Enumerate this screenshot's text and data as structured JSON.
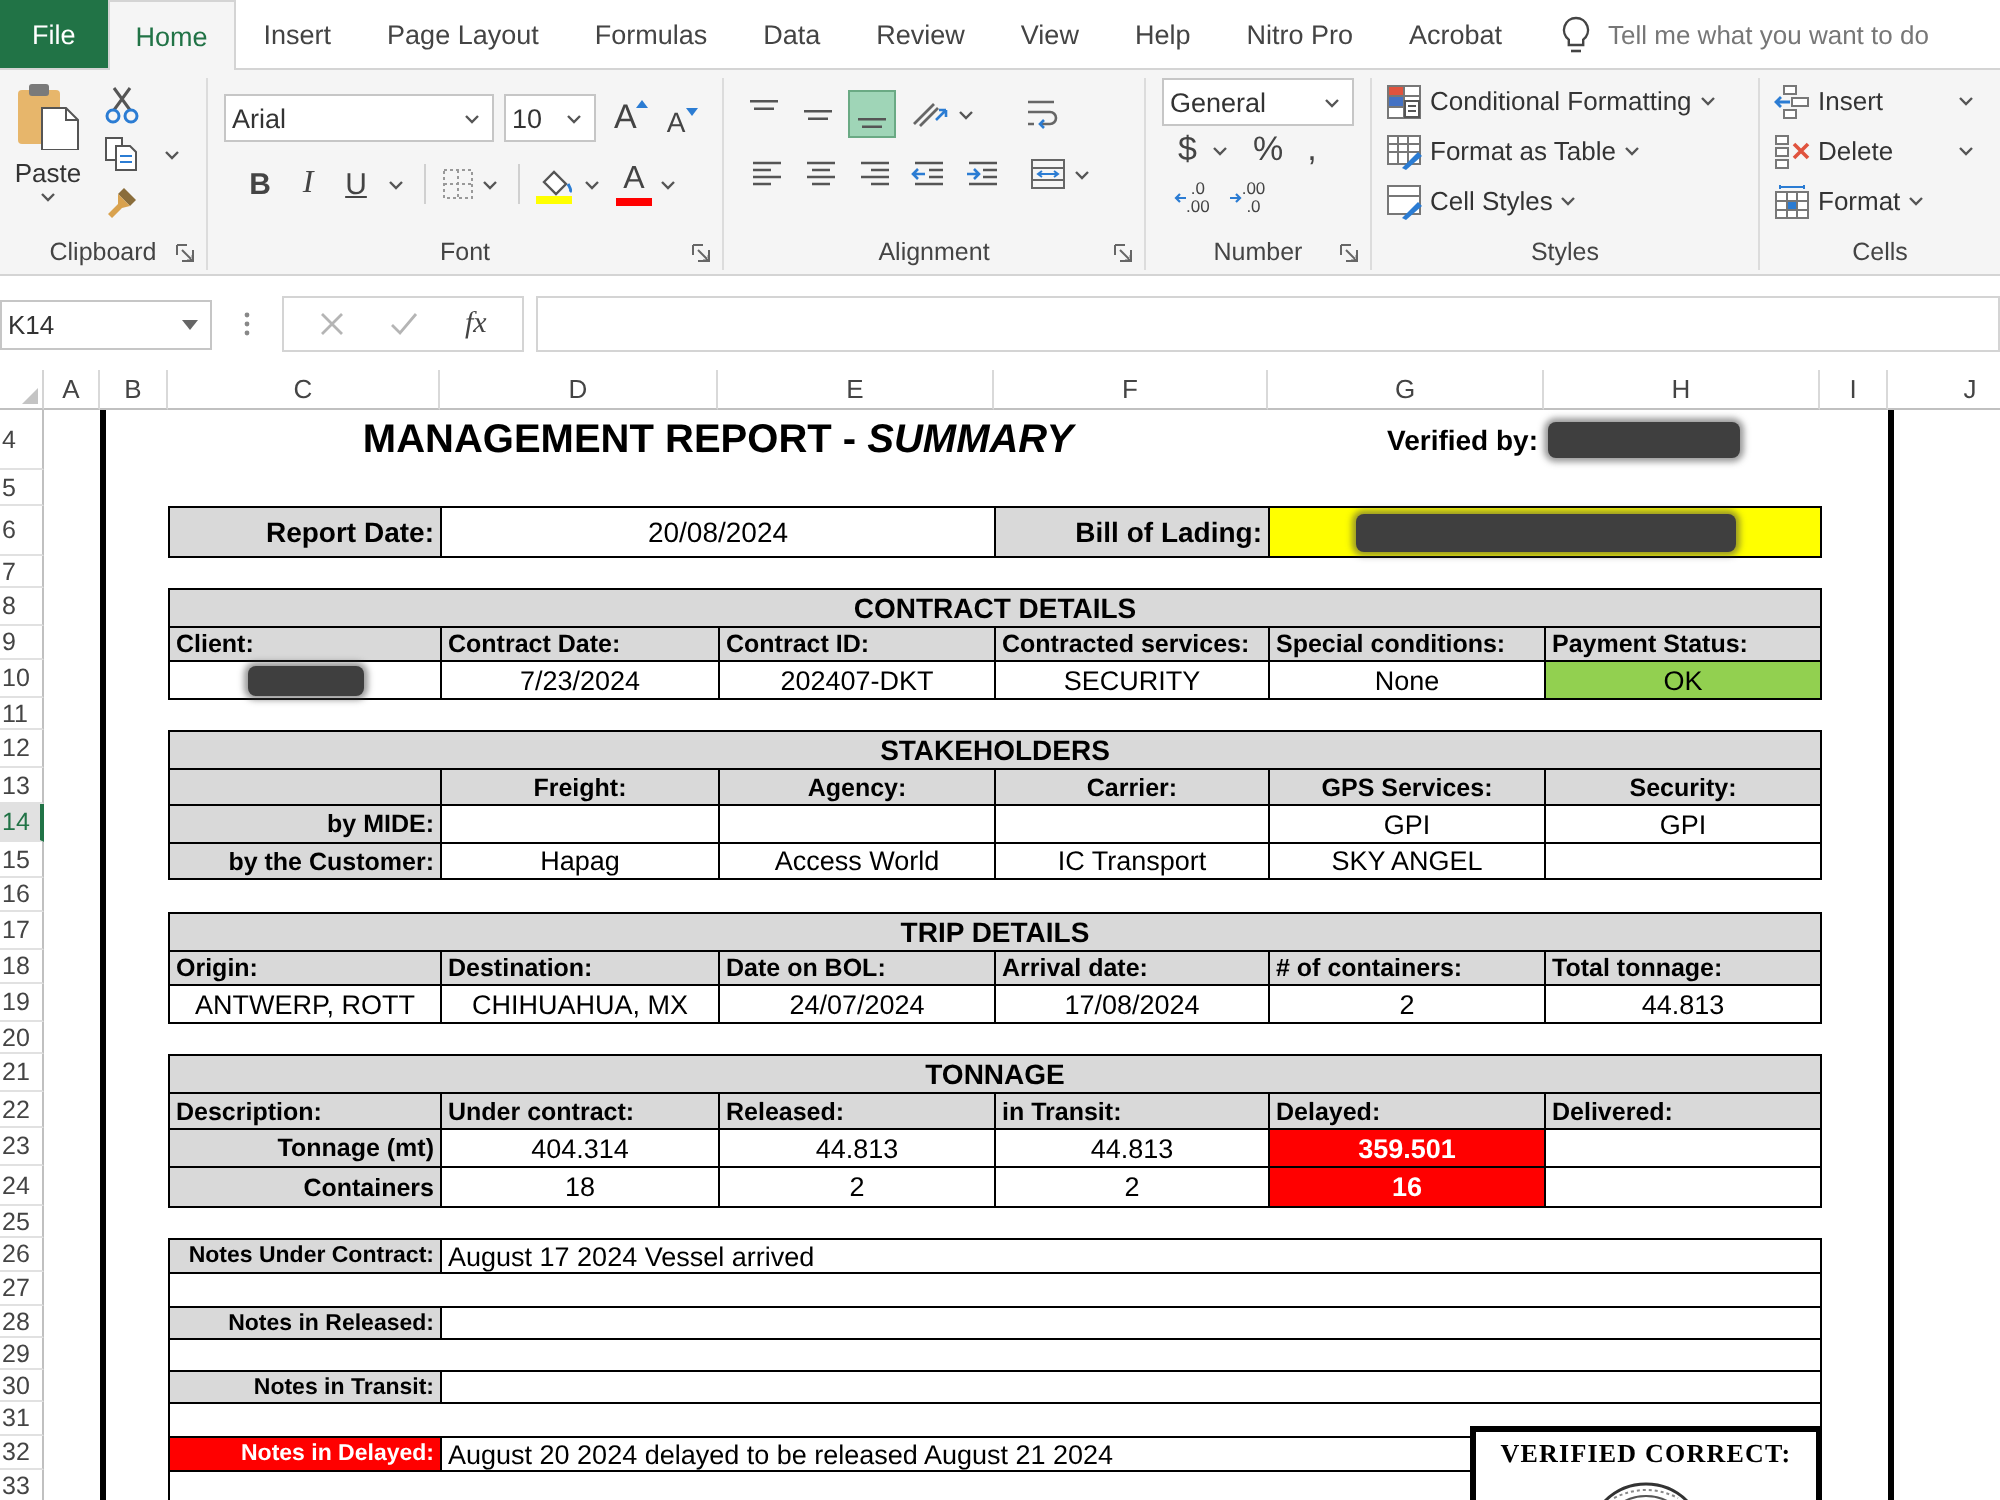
{
  "ribbon_tabs": [
    {
      "label": "File",
      "kind": "file",
      "selected": false
    },
    {
      "label": "Home",
      "kind": "tab",
      "selected": true
    },
    {
      "label": "Insert",
      "kind": "tab",
      "selected": false
    },
    {
      "label": "Page Layout",
      "kind": "tab",
      "selected": false
    },
    {
      "label": "Formulas",
      "kind": "tab",
      "selected": false
    },
    {
      "label": "Data",
      "kind": "tab",
      "selected": false
    },
    {
      "label": "Review",
      "kind": "tab",
      "selected": false
    },
    {
      "label": "View",
      "kind": "tab",
      "selected": false
    },
    {
      "label": "Help",
      "kind": "tab",
      "selected": false
    },
    {
      "label": "Nitro Pro",
      "kind": "tab",
      "selected": false
    },
    {
      "label": "Acrobat",
      "kind": "tab",
      "selected": false
    }
  ],
  "tell_me": {
    "placeholder": "Tell me what you want to do"
  },
  "ribbon": {
    "clipboard": {
      "label": "Clipboard",
      "paste": "Paste"
    },
    "font": {
      "label": "Font",
      "font_name": "Arial",
      "font_size": "10",
      "size_buttons": [
        {
          "kind": "grow",
          "glyph": "A"
        },
        {
          "kind": "shrink",
          "glyph": "A"
        }
      ],
      "format_buttons": [
        {
          "kind": "bold",
          "glyph": "B"
        },
        {
          "kind": "italic",
          "glyph": "I"
        },
        {
          "kind": "underline",
          "glyph": "U"
        }
      ],
      "font_color": {
        "glyph": "A"
      }
    },
    "alignment": {
      "label": "Alignment",
      "vertical": [
        {
          "kind": "top",
          "selected": false
        },
        {
          "kind": "middle",
          "selected": false
        },
        {
          "kind": "bottom",
          "selected": true
        }
      ]
    },
    "number": {
      "label": "Number",
      "format": "General",
      "symbols": [
        "$",
        "%",
        ","
      ],
      "decimals": [
        {
          "kind": "increase",
          "lines": [
            ".0",
            ".00"
          ]
        },
        {
          "kind": "decrease",
          "lines": [
            ".00",
            ".0"
          ]
        }
      ]
    },
    "styles": {
      "label": "Styles",
      "buttons": [
        {
          "kind": "conditional",
          "label": "Conditional Formatting"
        },
        {
          "kind": "table",
          "label": "Format as Table"
        },
        {
          "kind": "cell_styles",
          "label": "Cell Styles"
        }
      ]
    },
    "cells": {
      "label": "Cells",
      "buttons": [
        {
          "kind": "insert",
          "label": "Insert"
        },
        {
          "kind": "delete",
          "label": "Delete"
        },
        {
          "kind": "format",
          "label": "Format"
        }
      ]
    }
  },
  "formula_bar": {
    "name_box": "K14",
    "function_glyph": "fx"
  },
  "sheet": {
    "columns": [
      "A",
      "B",
      "C",
      "D",
      "E",
      "F",
      "G",
      "H",
      "I",
      "J"
    ],
    "rows": [
      {
        "label": "4",
        "selected": false
      },
      {
        "label": "5",
        "selected": false
      },
      {
        "label": "6",
        "selected": false
      },
      {
        "label": "7",
        "selected": false
      },
      {
        "label": "8",
        "selected": false
      },
      {
        "label": "9",
        "selected": false
      },
      {
        "label": "10",
        "selected": false
      },
      {
        "label": "11",
        "selected": false
      },
      {
        "label": "12",
        "selected": false
      },
      {
        "label": "13",
        "selected": false
      },
      {
        "label": "14",
        "selected": true
      },
      {
        "label": "15",
        "selected": false
      },
      {
        "label": "16",
        "selected": false
      },
      {
        "label": "17",
        "selected": false
      },
      {
        "label": "18",
        "selected": false
      },
      {
        "label": "19",
        "selected": false
      },
      {
        "label": "20",
        "selected": false
      },
      {
        "label": "21",
        "selected": false
      },
      {
        "label": "22",
        "selected": false
      },
      {
        "label": "23",
        "selected": false
      },
      {
        "label": "24",
        "selected": false
      },
      {
        "label": "25",
        "selected": false
      },
      {
        "label": "26",
        "selected": false
      },
      {
        "label": "27",
        "selected": false
      },
      {
        "label": "28",
        "selected": false
      },
      {
        "label": "29",
        "selected": false
      },
      {
        "label": "30",
        "selected": false
      },
      {
        "label": "31",
        "selected": false
      },
      {
        "label": "32",
        "selected": false
      },
      {
        "label": "33",
        "selected": false
      }
    ]
  },
  "report": {
    "title": "MANAGEMENT REPORT - *SUMMARY*",
    "verified_by": {
      "label": "Verified by:",
      "redacted": true
    },
    "header_fields": [
      {
        "label": "Report Date:",
        "value": "20/08/2024",
        "highlighted": false,
        "redacted": false
      },
      {
        "label": "Bill of Lading:",
        "highlighted": true,
        "redacted": true
      }
    ],
    "contract_details": {
      "title": "CONTRACT DETAILS",
      "columns": [
        "Client:",
        "Contract Date:",
        "Contract ID:",
        "Contracted services:",
        "Special conditions:",
        "Payment Status:"
      ],
      "values": [
        {
          "redacted": true,
          "highlighted": false
        },
        {
          "text": "7/23/2024",
          "redacted": false,
          "highlighted": false
        },
        {
          "text": "202407-DKT",
          "redacted": false,
          "highlighted": false
        },
        {
          "text": "SECURITY",
          "redacted": false,
          "highlighted": false
        },
        {
          "text": "None",
          "redacted": false,
          "highlighted": false
        },
        {
          "text": "OK",
          "redacted": false,
          "highlighted": true
        }
      ]
    },
    "stakeholders": {
      "title": "STAKEHOLDERS",
      "columns": [
        "Freight:",
        "Agency:",
        "Carrier:",
        "GPS Services:",
        "Security:"
      ],
      "rows": [
        {
          "label": "by MIDE:",
          "cells": [
            null,
            null,
            null,
            "GPI",
            "GPI"
          ]
        },
        {
          "label": "by the Customer:",
          "cells": [
            "Hapag",
            "Access World",
            "IC Transport",
            "SKY ANGEL",
            null
          ]
        }
      ]
    },
    "trip_details": {
      "title": "TRIP DETAILS",
      "columns": [
        "Origin:",
        "Destination:",
        "Date on BOL:",
        "Arrival date:",
        "# of containers:",
        "Total tonnage:"
      ],
      "values": [
        "ANTWERP, ROTT",
        "CHIHUAHUA, MX",
        "24/07/2024",
        "17/08/2024",
        "2",
        "44.813"
      ]
    },
    "tonnage": {
      "title": "TONNAGE",
      "corner_header": "Description:",
      "columns": [
        "Under contract:",
        "Released:",
        "in Transit:",
        "Delayed:",
        "Delivered:"
      ],
      "rows": [
        {
          "label": "Tonnage (mt)",
          "cells": [
            {
              "text": "404.314",
              "highlighted": false
            },
            {
              "text": "44.813",
              "highlighted": false
            },
            {
              "text": "44.813",
              "highlighted": false
            },
            {
              "text": "359.501",
              "highlighted": true
            },
            null
          ]
        },
        {
          "label": "Containers",
          "cells": [
            {
              "text": "18",
              "highlighted": false
            },
            {
              "text": "2",
              "highlighted": false
            },
            {
              "text": "2",
              "highlighted": false
            },
            {
              "text": "16",
              "highlighted": true
            },
            null
          ]
        }
      ]
    },
    "notes": [
      {
        "label": "Notes Under Contract:",
        "text": "August 17 2024 Vessel arrived",
        "highlighted": false
      },
      {
        "label": "Notes in Released:",
        "highlighted": false
      },
      {
        "label": "Notes in Transit:",
        "highlighted": false
      },
      {
        "label": "Notes in Delayed:",
        "text": "August 20 2024 delayed to be released August 21 2024",
        "highlighted": true
      }
    ],
    "stamp": {
      "title": "VERIFIED CORRECT:"
    }
  }
}
